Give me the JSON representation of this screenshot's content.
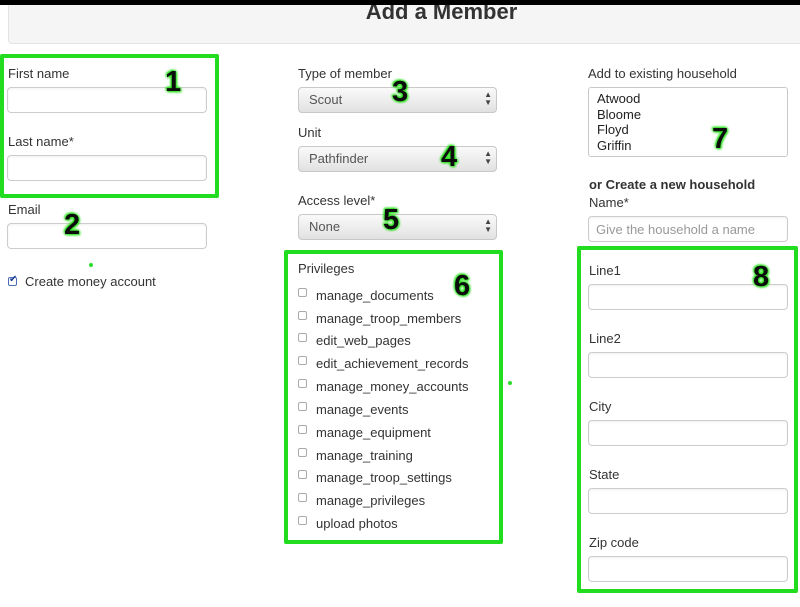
{
  "header": {
    "title": "Add a Member"
  },
  "column1": {
    "first_name_label": "First name",
    "first_name_value": "",
    "last_name_label": "Last name",
    "last_name_required": "*",
    "last_name_value": "",
    "email_label": "Email",
    "email_value": "",
    "create_money_account_label": "Create money account",
    "create_money_account_checked": true
  },
  "column2": {
    "type_of_member_label": "Type of member",
    "type_of_member_value": "Scout",
    "unit_label": "Unit",
    "unit_value": "Pathfinder",
    "access_level_label": "Access level",
    "access_level_required": "*",
    "access_level_value": "None",
    "privileges_label": "Privileges",
    "privileges": [
      "manage_documents",
      "manage_troop_members",
      "edit_web_pages",
      "edit_achievement_records",
      "manage_money_accounts",
      "manage_events",
      "manage_equipment",
      "manage_training",
      "manage_troop_settings",
      "manage_privileges",
      "upload photos"
    ]
  },
  "column3": {
    "existing_household_label": "Add to existing household",
    "households": [
      "Atwood",
      "Bloome",
      "Floyd",
      "Griffin"
    ],
    "new_household_label": "or Create a new household",
    "name_label": "Name",
    "name_required": "*",
    "name_placeholder": "Give the household a name",
    "line1_label": "Line1",
    "line2_label": "Line2",
    "city_label": "City",
    "state_label": "State",
    "zip_label": "Zip code"
  },
  "annotations": [
    "1",
    "2",
    "3",
    "4",
    "5",
    "6",
    "7",
    "8"
  ],
  "colors": {
    "annotation_green": "#22dd1f",
    "checkbox_blue": "#1c3f94"
  },
  "icons": {
    "select_arrow": "updown-arrow-icon",
    "checkbox_checked": "checkmark-icon"
  }
}
